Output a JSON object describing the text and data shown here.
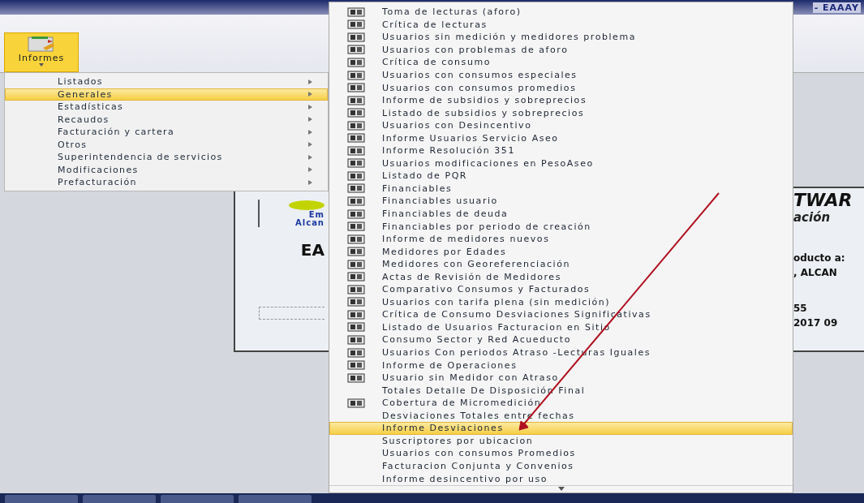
{
  "window": {
    "title": "- EAAAY"
  },
  "ribbon": {
    "button": {
      "label": "Informes",
      "selected": true
    }
  },
  "menu": {
    "items": [
      {
        "label": "Listados",
        "selected": false
      },
      {
        "label": "Generales",
        "selected": true
      },
      {
        "label": "Estadísticas",
        "selected": false
      },
      {
        "label": "Recaudos",
        "selected": false
      },
      {
        "label": "Facturación y cartera",
        "selected": false
      },
      {
        "label": "Otros",
        "selected": false
      },
      {
        "label": "Superintendencia de servicios",
        "selected": false
      },
      {
        "label": "Modificaciones",
        "selected": false
      },
      {
        "label": "Prefacturación",
        "selected": false
      }
    ]
  },
  "submenu": {
    "items": [
      {
        "label": "Toma de lecturas (aforo)",
        "icon": true,
        "selected": false
      },
      {
        "label": "Crítica de lecturas",
        "icon": true,
        "selected": false
      },
      {
        "label": "Usuarios sin medición y medidores problema",
        "icon": true,
        "selected": false
      },
      {
        "label": "Usuarios con problemas de aforo",
        "icon": true,
        "selected": false
      },
      {
        "label": "Crítica de consumo",
        "icon": true,
        "selected": false
      },
      {
        "label": "Usuarios con consumos especiales",
        "icon": true,
        "selected": false
      },
      {
        "label": "Usuarios con consumos promedios",
        "icon": true,
        "selected": false
      },
      {
        "label": "Informe de subsidios y sobreprecios",
        "icon": true,
        "selected": false
      },
      {
        "label": "Listado de subsidios y sobreprecios",
        "icon": true,
        "selected": false
      },
      {
        "label": "Usuarios con Desincentivo",
        "icon": true,
        "selected": false
      },
      {
        "label": "Informe Usuarios Servicio Aseo",
        "icon": true,
        "selected": false
      },
      {
        "label": "Informe Resolución 351",
        "icon": true,
        "selected": false
      },
      {
        "label": "Usuarios modificaciones en PesoAseo",
        "icon": true,
        "selected": false
      },
      {
        "label": "Listado de PQR",
        "icon": true,
        "selected": false
      },
      {
        "label": "Financiables",
        "icon": true,
        "selected": false
      },
      {
        "label": "Financiables usuario",
        "icon": true,
        "selected": false
      },
      {
        "label": "Financiables de deuda",
        "icon": true,
        "selected": false
      },
      {
        "label": "Financiables por periodo de creación",
        "icon": true,
        "selected": false
      },
      {
        "label": "Informe de medidores nuevos",
        "icon": true,
        "selected": false
      },
      {
        "label": "Medidores por Edades",
        "icon": true,
        "selected": false
      },
      {
        "label": "Medidores con Georeferenciación",
        "icon": true,
        "selected": false
      },
      {
        "label": "Actas de Revisión de Medidores",
        "icon": true,
        "selected": false
      },
      {
        "label": "Comparativo Consumos y Facturados",
        "icon": true,
        "selected": false
      },
      {
        "label": "Usuarios con tarifa plena (sin medición)",
        "icon": true,
        "selected": false
      },
      {
        "label": "Crítica de Consumo Desviaciones Significativas",
        "icon": true,
        "selected": false
      },
      {
        "label": "Listado de Usuarios Facturacion en Sitio",
        "icon": true,
        "selected": false
      },
      {
        "label": "Consumo Sector y Red Acueducto",
        "icon": true,
        "selected": false
      },
      {
        "label": "Usuarios Con periodos Atraso -Lecturas Iguales",
        "icon": true,
        "selected": false
      },
      {
        "label": "Informe de Operaciones",
        "icon": true,
        "selected": false
      },
      {
        "label": "Usuario sin Medidor con Atraso",
        "icon": true,
        "selected": false
      },
      {
        "label": "Totales Detalle De Disposición Final",
        "icon": false,
        "selected": false
      },
      {
        "label": "Cobertura de Micromedición",
        "icon": true,
        "selected": false
      },
      {
        "label": "Desviaciones Totales entre fechas",
        "icon": false,
        "selected": false
      },
      {
        "label": "Informe Desviaciones",
        "icon": false,
        "selected": true
      },
      {
        "label": "Suscriptores por ubicacion",
        "icon": false,
        "selected": false
      },
      {
        "label": "Usuarios con consumos Promedios",
        "icon": false,
        "selected": false
      },
      {
        "label": "Facturacion Conjunta y Convenios",
        "icon": false,
        "selected": false
      },
      {
        "label": "Informe desincentivo por uso",
        "icon": false,
        "selected": false
      }
    ]
  },
  "splash": {
    "logo_lines": [
      "Em",
      "Alcan"
    ],
    "heading": "EA",
    "right": [
      {
        "kind": "title",
        "text": "TWAR"
      },
      {
        "kind": "subtitle",
        "text": "ación"
      },
      {
        "kind": "line",
        "text": "oducto a:"
      },
      {
        "kind": "line",
        "text": ", ALCAN"
      },
      {
        "kind": "gap",
        "text": "55"
      },
      {
        "kind": "line",
        "text": "2017 09"
      }
    ]
  }
}
